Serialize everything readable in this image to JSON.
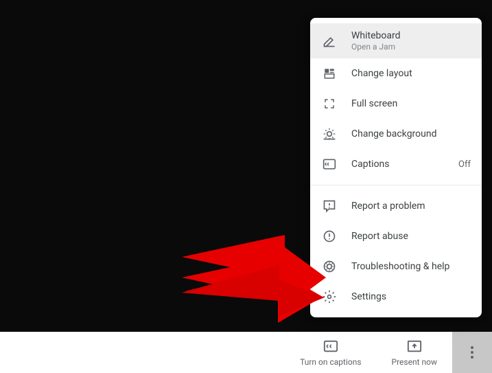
{
  "menu": {
    "whiteboard": {
      "label": "Whiteboard",
      "sublabel": "Open a Jam"
    },
    "change_layout": {
      "label": "Change layout"
    },
    "full_screen": {
      "label": "Full screen"
    },
    "change_background": {
      "label": "Change background"
    },
    "captions": {
      "label": "Captions",
      "status": "Off"
    },
    "report_problem": {
      "label": "Report a problem"
    },
    "report_abuse": {
      "label": "Report abuse"
    },
    "troubleshooting": {
      "label": "Troubleshooting & help"
    },
    "settings": {
      "label": "Settings"
    }
  },
  "bottom_bar": {
    "captions": {
      "label": "Turn on captions"
    },
    "present": {
      "label": "Present now"
    }
  }
}
